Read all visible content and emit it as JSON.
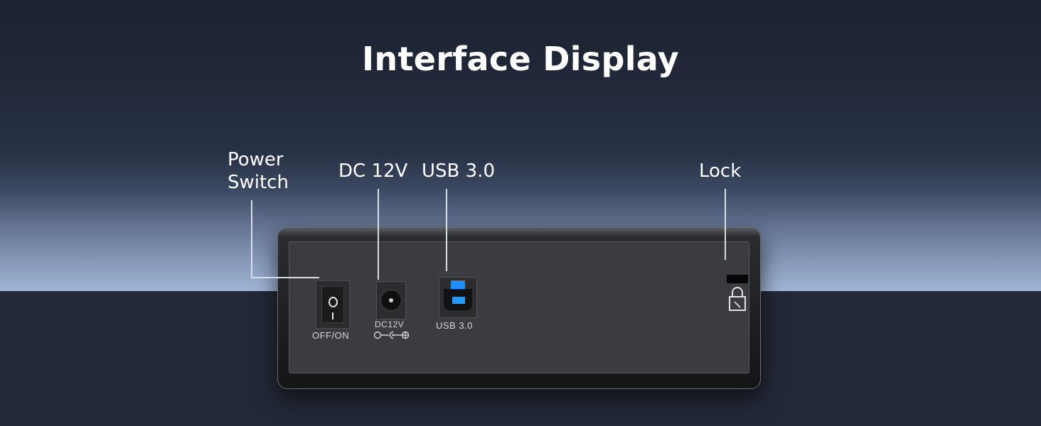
{
  "title": "Interface Display",
  "callouts": {
    "power_switch": "Power\nSwitch",
    "dc": "DC 12V",
    "usb": "USB 3.0",
    "lock": "Lock"
  },
  "device_labels": {
    "switch": "OFF/ON",
    "dc": "DC12V",
    "usb": "USB 3.0"
  },
  "colors": {
    "usb_accent": "#1e90ff",
    "text": "#ffffff"
  },
  "icons": {
    "lock": "padlock-icon",
    "dc_polarity": "dc-polarity-icon"
  }
}
